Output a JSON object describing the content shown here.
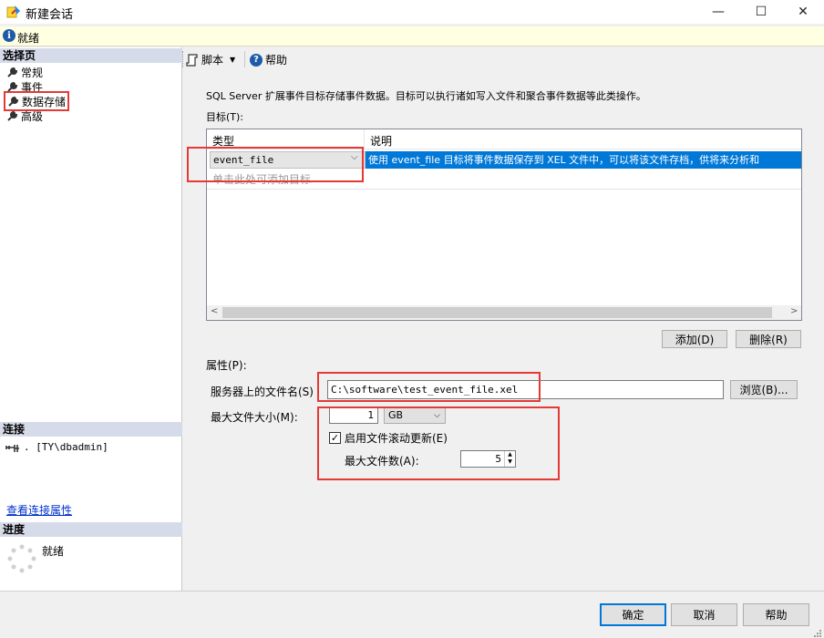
{
  "window": {
    "title": "新建会话",
    "minimize_glyph": "—",
    "maximize_glyph": "☐",
    "close_glyph": "✕"
  },
  "status": {
    "text": "就绪",
    "icon": "info-icon"
  },
  "left_pane": {
    "select_page_header": "选择页",
    "pages": [
      "常规",
      "事件",
      "数据存储",
      "高级"
    ],
    "selected_page_index": 2,
    "connection_header": "连接",
    "connection_text": ". [TY\\dbadmin]",
    "view_connection_link": "查看连接属性",
    "progress_header": "进度",
    "progress_text": "就绪"
  },
  "toolbar": {
    "script_label": "脚本",
    "help_label": "帮助"
  },
  "content": {
    "description": "SQL Server 扩展事件目标存储事件数据。目标可以执行诸如写入文件和聚合事件数据等此类操作。",
    "targets_label": "目标(T):",
    "grid": {
      "columns": [
        "类型",
        "说明"
      ],
      "rows": [
        {
          "type": "event_file",
          "description": "使用 event_file 目标将事件数据保存到 XEL 文件中，可以将该文件存档，供将来分析和"
        }
      ],
      "add_target_hint": "单击此处可添加目标"
    },
    "add_button": "添加(D)",
    "delete_button": "删除(R)",
    "properties_label": "属性(P):",
    "file_name_label": "服务器上的文件名(S)",
    "file_name_value": "C:\\software\\test_event_file.xel",
    "browse_button": "浏览(B)...",
    "max_size_label": "最大文件大小(M):",
    "max_size_value": "1",
    "max_size_unit": "GB",
    "rollover_label": "启用文件滚动更新(E)",
    "rollover_checked": true,
    "max_files_label": "最大文件数(A):",
    "max_files_value": "5"
  },
  "dialog_buttons": {
    "ok": "确定",
    "cancel": "取消",
    "help": "帮助"
  },
  "colors": {
    "selection": "#0078d7",
    "highlight_box": "#e53935",
    "section_header": "#d6dbe9",
    "status_bar": "#ffffe1"
  }
}
